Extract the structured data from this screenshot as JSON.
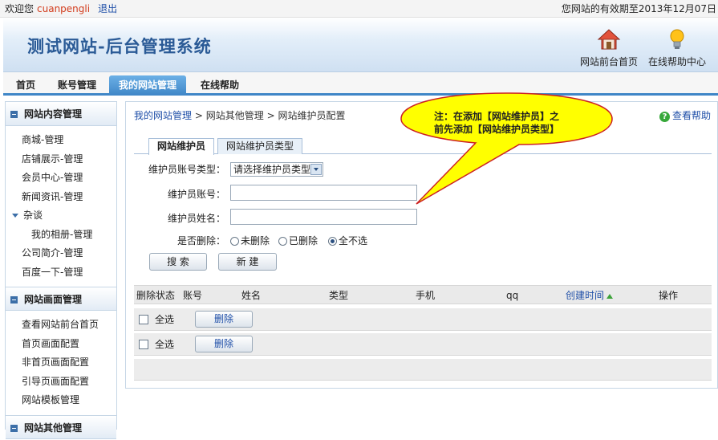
{
  "topbar": {
    "welcome": "欢迎您",
    "username": "cuanpengli",
    "logout": "退出",
    "expire": "您网站的有效期至2013年12月07日"
  },
  "header": {
    "title": "测试网站-后台管理系统",
    "home_link": "网站前台首页",
    "help_center": "在线帮助中心"
  },
  "nav": {
    "tabs": [
      {
        "label": "首页"
      },
      {
        "label": "账号管理"
      },
      {
        "label": "我的网站管理"
      },
      {
        "label": "在线帮助"
      }
    ],
    "active": "我的网站管理"
  },
  "sidebar": {
    "sections": [
      {
        "title": "网站内容管理",
        "items": [
          "商城-管理",
          "店铺展示-管理",
          "会员中心-管理",
          "新闻资讯-管理",
          "杂谈",
          "我的相册-管理",
          "公司简介-管理",
          "百度一下-管理"
        ]
      },
      {
        "title": "网站画面管理",
        "items": [
          "查看网站前台首页",
          "首页画面配置",
          "非首页画面配置",
          "引导页画面配置",
          "网站模板管理"
        ]
      },
      {
        "title": "网站其他管理",
        "items": []
      }
    ]
  },
  "main": {
    "breadcrumb": {
      "part1": "我的网站管理",
      "sep": ">",
      "part2": "网站其他管理",
      "part3": "网站维护员配置"
    },
    "help": "查看帮助",
    "subtabs": [
      "网站维护员",
      "网站维护员类型"
    ],
    "form": {
      "type_label": "维护员账号类型：",
      "type_value": "请选择维护员类型",
      "account_label": "维护员账号：",
      "account_value": "",
      "name_label": "维护员姓名：",
      "name_value": "",
      "deleted_label": "是否删除：",
      "radio_options": [
        "未删除",
        "已删除",
        "全不选"
      ],
      "radio_selected": "全不选",
      "search_button": "搜 索",
      "new_button": "新 建"
    },
    "table": {
      "headers": [
        "删除状态",
        "账号",
        "姓名",
        "类型",
        "手机",
        "qq",
        "创建时间",
        "操作"
      ],
      "rows": [
        {
          "select_all": "全选",
          "delete": "删除"
        },
        {
          "select_all": "全选",
          "delete": "删除"
        }
      ]
    }
  },
  "callout": {
    "text_line1": "注：在添加【网站维护员】之",
    "text_line2": "前先添加【网站维护员类型】",
    "fill": "#ffff00",
    "stroke": "#cc2222"
  }
}
